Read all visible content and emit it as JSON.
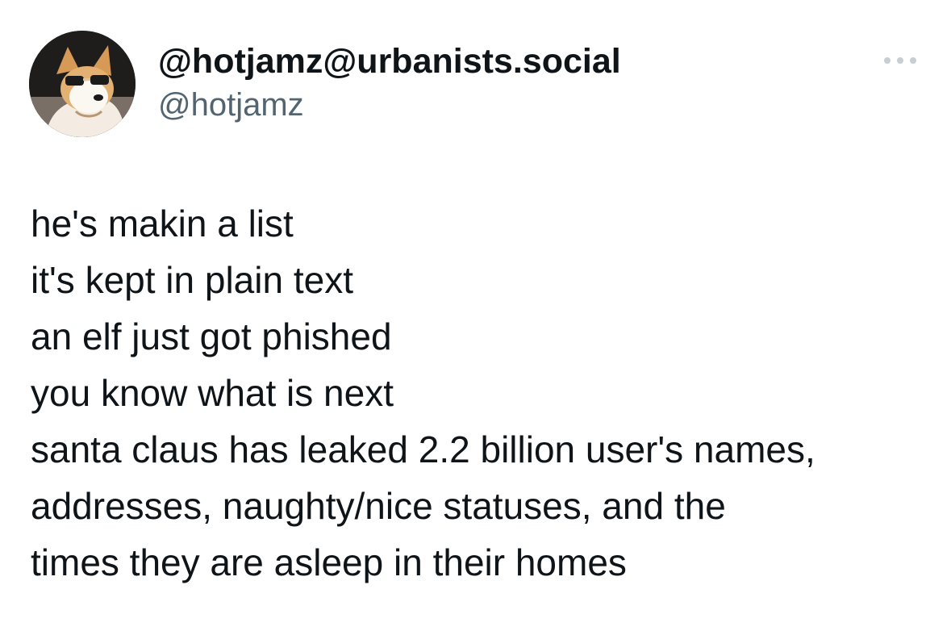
{
  "post": {
    "author": {
      "display_name": "@hotjamz@urbanists.social",
      "handle": "@hotjamz",
      "avatar_icon": "dog-with-sunglasses-avatar"
    },
    "more_icon": "ellipsis-icon",
    "text_lines": [
      "he's makin a list",
      "it's kept in plain text",
      "an elf just got phished",
      "you know what is next",
      "santa claus has leaked 2.2 billion user's names,",
      "addresses, naughty/nice statuses, and the",
      "times they are asleep in their homes"
    ],
    "colors": {
      "text": "#0f1419",
      "secondary_text": "#536471",
      "icon": "#536471",
      "background": "#ffffff"
    }
  }
}
